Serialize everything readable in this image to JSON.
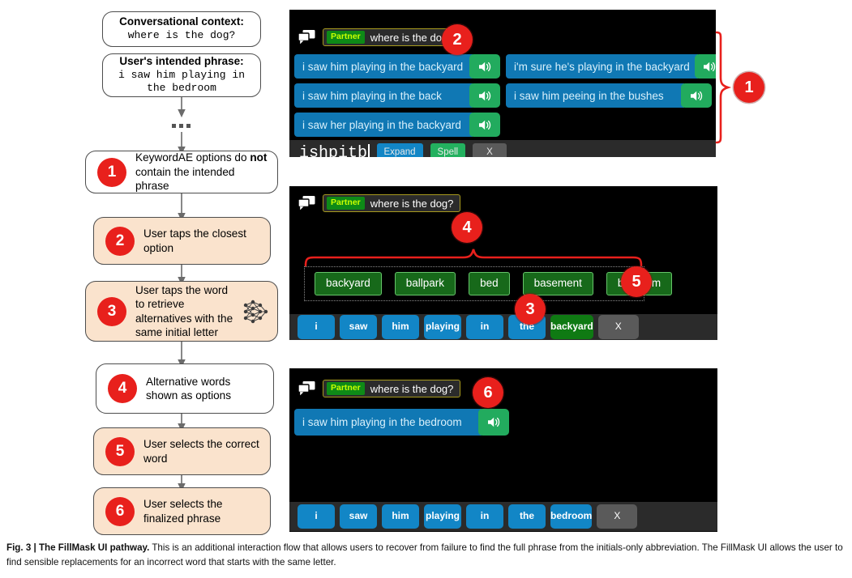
{
  "flow": {
    "context_box": {
      "title": "Conversational context:",
      "value": "where is the dog?"
    },
    "intent_box": {
      "title": "User's intended phrase:",
      "value": "i saw him playing in the bedroom"
    },
    "ellipsis": "...",
    "steps": [
      {
        "num": "1",
        "text_before": "KeywordAE options do ",
        "emphasis": "not",
        "text_after": " contain the intended phrase",
        "tinted": false,
        "icon": null
      },
      {
        "num": "2",
        "text_before": "User taps the closest option",
        "emphasis": "",
        "text_after": "",
        "tinted": true,
        "icon": null
      },
      {
        "num": "3",
        "text_before": "User taps the word to retrieve alternatives with the same initial letter",
        "emphasis": "",
        "text_after": "",
        "tinted": true,
        "icon": "neural-network-icon"
      },
      {
        "num": "4",
        "text_before": "Alternative words shown as options",
        "emphasis": "",
        "text_after": "",
        "tinted": false,
        "icon": null
      },
      {
        "num": "5",
        "text_before": "User selects the correct word",
        "emphasis": "",
        "text_after": "",
        "tinted": true,
        "icon": null
      },
      {
        "num": "6",
        "text_before": "User selects the finalized phrase",
        "emphasis": "",
        "text_after": "",
        "tinted": true,
        "icon": null
      }
    ]
  },
  "panels": [
    {
      "id": "panel-keywordae",
      "context": {
        "speaker": "Partner",
        "message": "where is the dog?"
      },
      "options_left": [
        "i saw him playing in the backyard",
        "i saw him playing in the back",
        "i saw her playing in the backyard"
      ],
      "options_right": [
        "i'm sure he's playing in the backyard",
        "i saw him peeing in the bushes"
      ],
      "composer": {
        "typed_text": "ishpitb",
        "expand_label": "Expand",
        "spell_label": "Spell",
        "clear_label": "X"
      },
      "callouts": [
        {
          "num": "2"
        },
        {
          "num": "1"
        }
      ]
    },
    {
      "id": "panel-fillmask",
      "context": {
        "speaker": "Partner",
        "message": "where is the dog?"
      },
      "alternatives": [
        "backyard",
        "ballpark",
        "bed",
        "basement",
        "bedroom"
      ],
      "word_chips": [
        {
          "label": "i",
          "state": "blue"
        },
        {
          "label": "saw",
          "state": "blue"
        },
        {
          "label": "him",
          "state": "blue"
        },
        {
          "label": "playing",
          "state": "blue"
        },
        {
          "label": "in",
          "state": "blue"
        },
        {
          "label": "the",
          "state": "blue"
        },
        {
          "label": "backyard",
          "state": "green"
        },
        {
          "label": "X",
          "state": "grey"
        }
      ],
      "callouts": [
        {
          "num": "4"
        },
        {
          "num": "5"
        },
        {
          "num": "3"
        }
      ]
    },
    {
      "id": "panel-final",
      "context": {
        "speaker": "Partner",
        "message": "where is the dog?"
      },
      "final_phrase": "i saw him playing in the bedroom",
      "word_chips": [
        {
          "label": "i",
          "state": "blue"
        },
        {
          "label": "saw",
          "state": "blue"
        },
        {
          "label": "him",
          "state": "blue"
        },
        {
          "label": "playing",
          "state": "blue"
        },
        {
          "label": "in",
          "state": "blue"
        },
        {
          "label": "the",
          "state": "blue"
        },
        {
          "label": "bedroom",
          "state": "blue"
        },
        {
          "label": "X",
          "state": "grey"
        }
      ],
      "callouts": [
        {
          "num": "6"
        }
      ]
    }
  ],
  "caption": {
    "figure_label": "Fig. 3",
    "separator": " | ",
    "title": "The FillMask UI pathway.",
    "body": " This is an additional interaction flow that allows users to recover from failure to find the full phrase from the initials-only abbreviation. The FillMask UI allows the user to find sensible replacements for an incorrect word that starts with the same letter."
  },
  "colors": {
    "accent_red": "#e8201c",
    "chip_blue": "#1286c6",
    "chip_green": "#0f7a13",
    "speaker_green": "#22ab5e",
    "option_blue": "#1078b4",
    "tint_peach": "#fae3cd",
    "panel_black": "#000000",
    "tray_grey": "#2b2b2b",
    "badge_border_olive": "#a79a1e"
  }
}
